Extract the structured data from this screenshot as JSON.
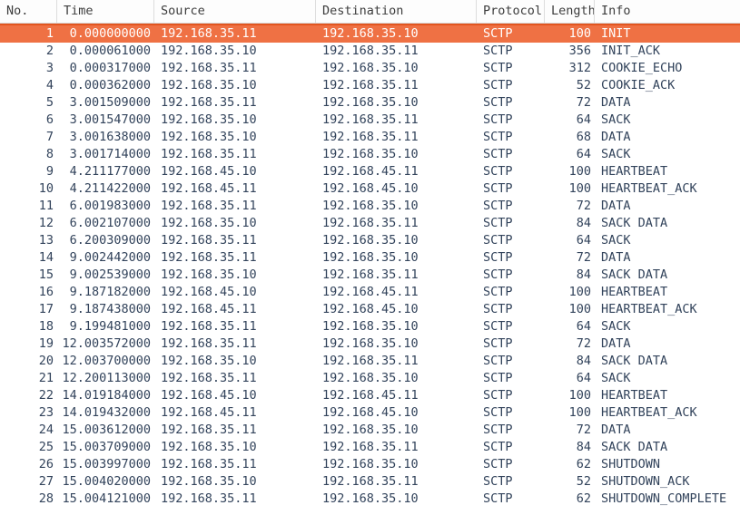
{
  "table": {
    "columns": [
      {
        "key": "no",
        "label": "No.",
        "align": "right"
      },
      {
        "key": "time",
        "label": "Time",
        "align": "right"
      },
      {
        "key": "src",
        "label": "Source",
        "align": "left"
      },
      {
        "key": "dst",
        "label": "Destination",
        "align": "left"
      },
      {
        "key": "proto",
        "label": "Protocol",
        "align": "left"
      },
      {
        "key": "len",
        "label": "Length",
        "align": "right"
      },
      {
        "key": "info",
        "label": "Info",
        "align": "left"
      }
    ],
    "selected_row_index": 0,
    "colors": {
      "selected_background": "#ef7144",
      "selected_border_top": "#e2551f",
      "selected_text": "#ffffff",
      "row_text": "#32435b",
      "header_text": "#3c3c3c",
      "header_background": "#fdfdfd",
      "grid_line": "#dddddd",
      "body_background": "#ffffff"
    },
    "rows": [
      {
        "no": "1",
        "time": "0.000000000",
        "src": "192.168.35.11",
        "dst": "192.168.35.10",
        "proto": "SCTP",
        "len": "100",
        "info": "INIT"
      },
      {
        "no": "2",
        "time": "0.000061000",
        "src": "192.168.35.10",
        "dst": "192.168.35.11",
        "proto": "SCTP",
        "len": "356",
        "info": "INIT_ACK"
      },
      {
        "no": "3",
        "time": "0.000317000",
        "src": "192.168.35.11",
        "dst": "192.168.35.10",
        "proto": "SCTP",
        "len": "312",
        "info": "COOKIE_ECHO"
      },
      {
        "no": "4",
        "time": "0.000362000",
        "src": "192.168.35.10",
        "dst": "192.168.35.11",
        "proto": "SCTP",
        "len": "52",
        "info": "COOKIE_ACK"
      },
      {
        "no": "5",
        "time": "3.001509000",
        "src": "192.168.35.11",
        "dst": "192.168.35.10",
        "proto": "SCTP",
        "len": "72",
        "info": "DATA"
      },
      {
        "no": "6",
        "time": "3.001547000",
        "src": "192.168.35.10",
        "dst": "192.168.35.11",
        "proto": "SCTP",
        "len": "64",
        "info": "SACK"
      },
      {
        "no": "7",
        "time": "3.001638000",
        "src": "192.168.35.10",
        "dst": "192.168.35.11",
        "proto": "SCTP",
        "len": "68",
        "info": "DATA"
      },
      {
        "no": "8",
        "time": "3.001714000",
        "src": "192.168.35.11",
        "dst": "192.168.35.10",
        "proto": "SCTP",
        "len": "64",
        "info": "SACK"
      },
      {
        "no": "9",
        "time": "4.211177000",
        "src": "192.168.45.10",
        "dst": "192.168.45.11",
        "proto": "SCTP",
        "len": "100",
        "info": "HEARTBEAT"
      },
      {
        "no": "10",
        "time": "4.211422000",
        "src": "192.168.45.11",
        "dst": "192.168.45.10",
        "proto": "SCTP",
        "len": "100",
        "info": "HEARTBEAT_ACK"
      },
      {
        "no": "11",
        "time": "6.001983000",
        "src": "192.168.35.11",
        "dst": "192.168.35.10",
        "proto": "SCTP",
        "len": "72",
        "info": "DATA"
      },
      {
        "no": "12",
        "time": "6.002107000",
        "src": "192.168.35.10",
        "dst": "192.168.35.11",
        "proto": "SCTP",
        "len": "84",
        "info": "SACK DATA"
      },
      {
        "no": "13",
        "time": "6.200309000",
        "src": "192.168.35.11",
        "dst": "192.168.35.10",
        "proto": "SCTP",
        "len": "64",
        "info": "SACK"
      },
      {
        "no": "14",
        "time": "9.002442000",
        "src": "192.168.35.11",
        "dst": "192.168.35.10",
        "proto": "SCTP",
        "len": "72",
        "info": "DATA"
      },
      {
        "no": "15",
        "time": "9.002539000",
        "src": "192.168.35.10",
        "dst": "192.168.35.11",
        "proto": "SCTP",
        "len": "84",
        "info": "SACK DATA"
      },
      {
        "no": "16",
        "time": "9.187182000",
        "src": "192.168.45.10",
        "dst": "192.168.45.11",
        "proto": "SCTP",
        "len": "100",
        "info": "HEARTBEAT"
      },
      {
        "no": "17",
        "time": "9.187438000",
        "src": "192.168.45.11",
        "dst": "192.168.45.10",
        "proto": "SCTP",
        "len": "100",
        "info": "HEARTBEAT_ACK"
      },
      {
        "no": "18",
        "time": "9.199481000",
        "src": "192.168.35.11",
        "dst": "192.168.35.10",
        "proto": "SCTP",
        "len": "64",
        "info": "SACK"
      },
      {
        "no": "19",
        "time": "12.003572000",
        "src": "192.168.35.11",
        "dst": "192.168.35.10",
        "proto": "SCTP",
        "len": "72",
        "info": "DATA"
      },
      {
        "no": "20",
        "time": "12.003700000",
        "src": "192.168.35.10",
        "dst": "192.168.35.11",
        "proto": "SCTP",
        "len": "84",
        "info": "SACK DATA"
      },
      {
        "no": "21",
        "time": "12.200113000",
        "src": "192.168.35.11",
        "dst": "192.168.35.10",
        "proto": "SCTP",
        "len": "64",
        "info": "SACK"
      },
      {
        "no": "22",
        "time": "14.019184000",
        "src": "192.168.45.10",
        "dst": "192.168.45.11",
        "proto": "SCTP",
        "len": "100",
        "info": "HEARTBEAT"
      },
      {
        "no": "23",
        "time": "14.019432000",
        "src": "192.168.45.11",
        "dst": "192.168.45.10",
        "proto": "SCTP",
        "len": "100",
        "info": "HEARTBEAT_ACK"
      },
      {
        "no": "24",
        "time": "15.003612000",
        "src": "192.168.35.11",
        "dst": "192.168.35.10",
        "proto": "SCTP",
        "len": "72",
        "info": "DATA"
      },
      {
        "no": "25",
        "time": "15.003709000",
        "src": "192.168.35.10",
        "dst": "192.168.35.11",
        "proto": "SCTP",
        "len": "84",
        "info": "SACK DATA"
      },
      {
        "no": "26",
        "time": "15.003997000",
        "src": "192.168.35.11",
        "dst": "192.168.35.10",
        "proto": "SCTP",
        "len": "62",
        "info": "SHUTDOWN"
      },
      {
        "no": "27",
        "time": "15.004020000",
        "src": "192.168.35.10",
        "dst": "192.168.35.11",
        "proto": "SCTP",
        "len": "52",
        "info": "SHUTDOWN_ACK"
      },
      {
        "no": "28",
        "time": "15.004121000",
        "src": "192.168.35.11",
        "dst": "192.168.35.10",
        "proto": "SCTP",
        "len": "62",
        "info": "SHUTDOWN_COMPLETE"
      }
    ]
  }
}
